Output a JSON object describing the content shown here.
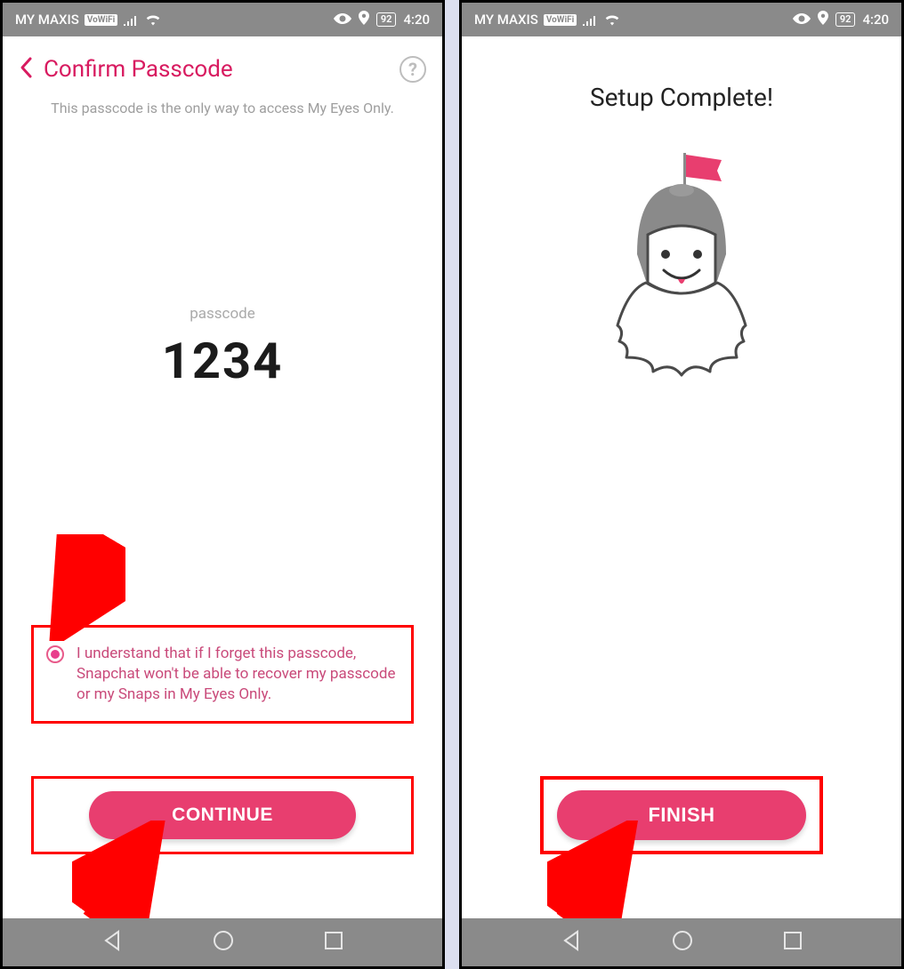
{
  "status": {
    "carrier": "MY MAXIS",
    "volte": "VoWiFi",
    "battery": "92",
    "time": "4:20"
  },
  "left": {
    "title": "Confirm Passcode",
    "subtitle": "This passcode is the only way to access My Eyes Only.",
    "passcode_label": "passcode",
    "passcode_value": "1234",
    "consent": "I understand that if I forget this passcode, Snapchat won't be able to recover my passcode or my Snaps in My Eyes Only.",
    "continue": "CONTINUE"
  },
  "right": {
    "title": "Setup Complete!",
    "finish": "FINISH"
  }
}
